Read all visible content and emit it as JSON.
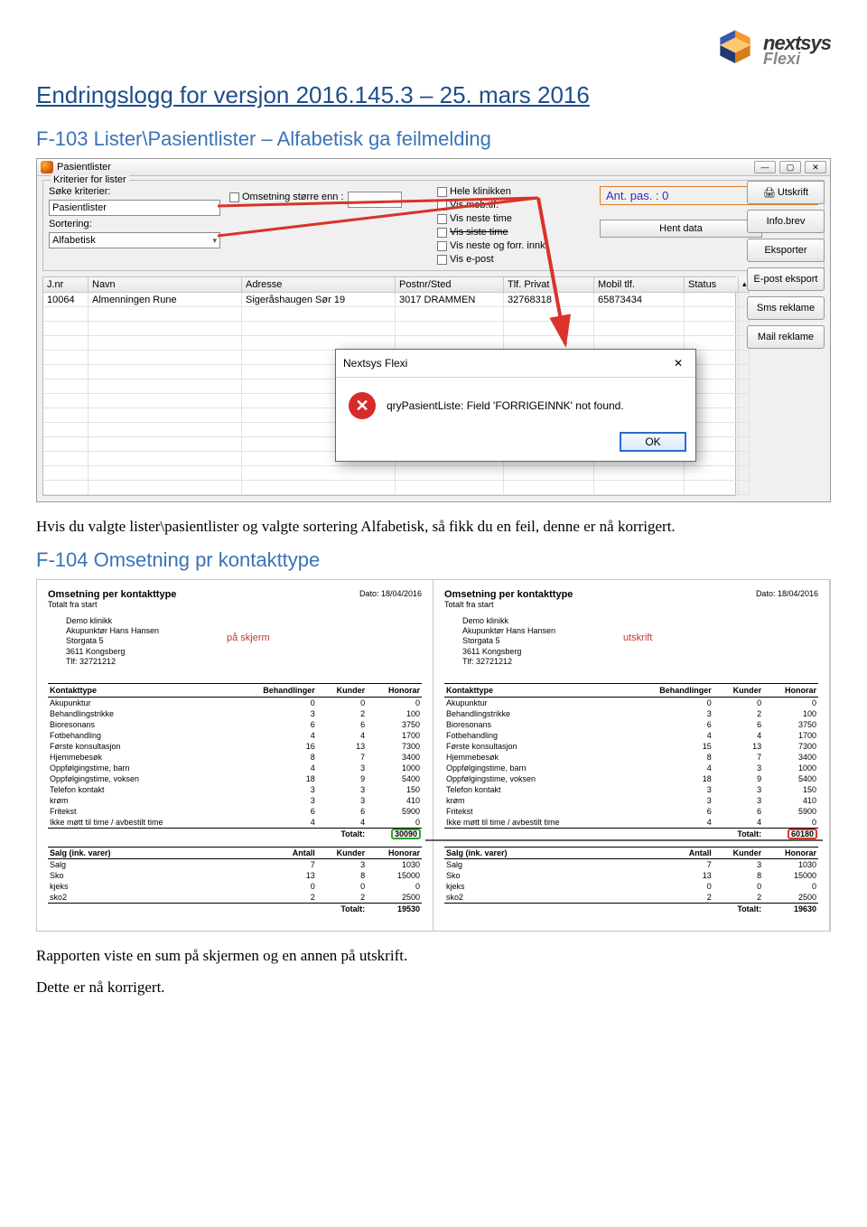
{
  "logo": {
    "brand": "nextsys",
    "sub": "Flexi"
  },
  "title": "Endringslogg for versjon 2016.145.3 – 25. mars 2016",
  "section1": {
    "heading": "F-103 Lister\\Pasientlister – Alfabetisk ga feilmelding",
    "body": "Hvis du valgte lister\\pasientlister og valgte sortering Alfabetisk, så fikk du en feil, denne er nå korrigert."
  },
  "win": {
    "title": "Pasientlister",
    "group_legend": "Kriterier for lister",
    "soke_label": "Søke kriterier:",
    "soke_value": "Pasientlister",
    "sortering_label": "Sortering:",
    "sortering_value": "Alfabetisk",
    "omsetning_label": "Omsetning større enn :",
    "chk_hele": "Hele klinikken",
    "chk_mob": "Vis mob.tlf.",
    "chk_neste": "Vis neste time",
    "chk_siste": "Vis siste time",
    "chk_nesteforr": "Vis neste og forr. innk.",
    "chk_epost": "Vis e-post",
    "ant_pas": "Ant. pas. : 0",
    "hent_data": "Hent data",
    "side_btns": [
      "Utskrift",
      "Info.brev",
      "Eksporter",
      "E-post eksport",
      "Sms reklame",
      "Mail reklame"
    ],
    "grid_headers": [
      "J.nr",
      "Navn",
      "Adresse",
      "Postnr/Sted",
      "Tlf. Privat",
      "Mobil tlf.",
      "Status"
    ],
    "grid_row": [
      "10064",
      "Almenningen Rune",
      "Sigeråshaugen Sør 19",
      "3017 DRAMMEN",
      "32768318",
      "65873434",
      ""
    ],
    "win_btns": [
      "—",
      "▢",
      "✕"
    ]
  },
  "dialog": {
    "title": "Nextsys Flexi",
    "msg": "qryPasientListe: Field 'FORRIGEINNK' not found.",
    "ok": "OK",
    "close": "✕"
  },
  "section2": {
    "heading": "F-104 Omsetning pr kontakttype",
    "body1": "Rapporten viste en sum på skjermen og en annen på utskrift.",
    "body2": "Dette er nå korrigert."
  },
  "report_common": {
    "title": "Omsetning per kontakttype",
    "sub": "Totalt fra start",
    "date_label": "Dato: 18/04/2016",
    "addr": [
      "Demo klinikk",
      "Akupunktør Hans Hansen",
      "Storgata 5",
      "3611 Kongsberg",
      "Tlf: 32721212"
    ],
    "th": [
      "Kontakttype",
      "Behandlinger",
      "Kunder",
      "Honorar"
    ],
    "th2": [
      "Salg (ink. varer)",
      "Antall",
      "Kunder",
      "Honorar"
    ]
  },
  "report_left": {
    "annot": "på skjerm",
    "rows": [
      [
        "Akupunktur",
        "0",
        "0",
        "0"
      ],
      [
        "Behandlingstrikke",
        "3",
        "2",
        "100"
      ],
      [
        "Bioresonans",
        "6",
        "6",
        "3750"
      ],
      [
        "Fotbehandling",
        "4",
        "4",
        "1700"
      ],
      [
        "Første konsultasjon",
        "16",
        "13",
        "7300"
      ],
      [
        "Hjemmebesøk",
        "8",
        "7",
        "3400"
      ],
      [
        "Oppfølgingstime, barn",
        "4",
        "3",
        "1000"
      ],
      [
        "Oppfølgingstime, voksen",
        "18",
        "9",
        "5400"
      ],
      [
        "Telefon kontakt",
        "3",
        "3",
        "150"
      ],
      [
        "krøm",
        "3",
        "3",
        "410"
      ],
      [
        "Fritekst",
        "6",
        "6",
        "5900"
      ],
      [
        "Ikke møtt til time / avbestilt time",
        "4",
        "4",
        "0"
      ]
    ],
    "totalt_label": "Totalt:",
    "totalt_value": "30090",
    "salg": [
      [
        "Salg",
        "7",
        "3",
        "1030"
      ],
      [
        "Sko",
        "13",
        "8",
        "15000"
      ],
      [
        "kjeks",
        "0",
        "0",
        "0"
      ],
      [
        "sko2",
        "2",
        "2",
        "2500"
      ]
    ],
    "salg_total_label": "Totalt:",
    "salg_total_value": "19530"
  },
  "report_right": {
    "annot": "utskrift",
    "rows": [
      [
        "Akupunktur",
        "0",
        "0",
        "0"
      ],
      [
        "Behandlingstrikke",
        "3",
        "2",
        "100"
      ],
      [
        "Bioresonans",
        "6",
        "6",
        "3750"
      ],
      [
        "Fotbehandling",
        "4",
        "4",
        "1700"
      ],
      [
        "Første konsultasjon",
        "15",
        "13",
        "7300"
      ],
      [
        "Hjemmebesøk",
        "8",
        "7",
        "3400"
      ],
      [
        "Oppfølgingstime, barn",
        "4",
        "3",
        "1000"
      ],
      [
        "Oppfølgingstime, voksen",
        "18",
        "9",
        "5400"
      ],
      [
        "Telefon kontakt",
        "3",
        "3",
        "150"
      ],
      [
        "krøm",
        "3",
        "3",
        "410"
      ],
      [
        "Fritekst",
        "6",
        "6",
        "5900"
      ],
      [
        "Ikke møtt til time / avbestilt time",
        "4",
        "4",
        "0"
      ]
    ],
    "totalt_label": "Totalt:",
    "totalt_value": "60180",
    "salg": [
      [
        "Salg",
        "7",
        "3",
        "1030"
      ],
      [
        "Sko",
        "13",
        "8",
        "15000"
      ],
      [
        "kjeks",
        "0",
        "0",
        "0"
      ],
      [
        "sko2",
        "2",
        "2",
        "2500"
      ]
    ],
    "salg_total_label": "Totalt:",
    "salg_total_value": "19630"
  }
}
